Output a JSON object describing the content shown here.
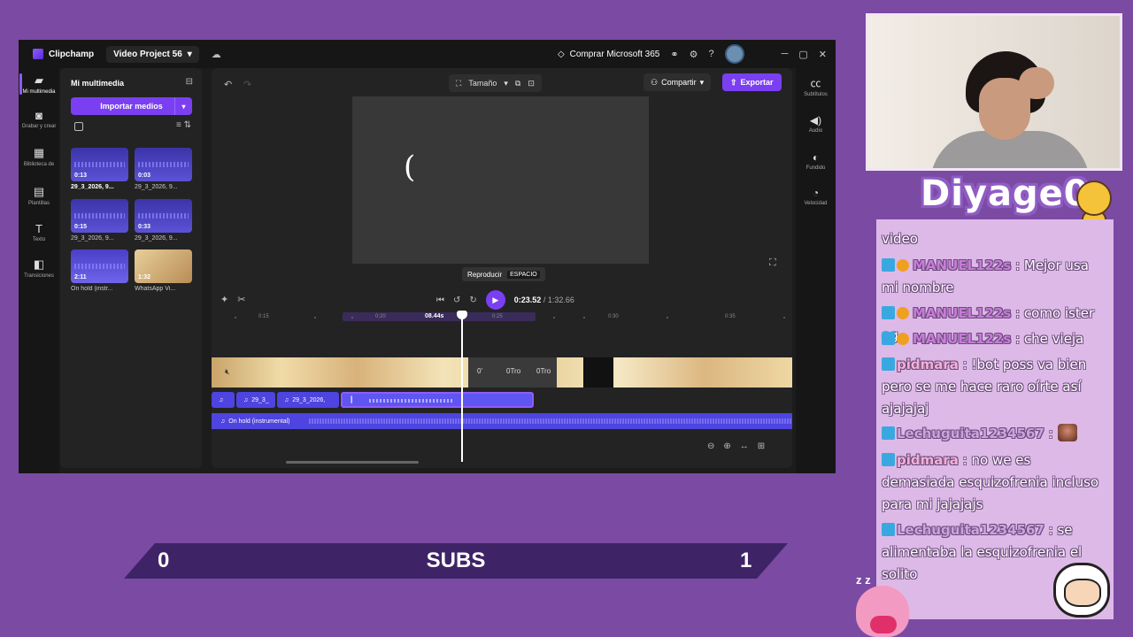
{
  "app": {
    "name": "Clipchamp",
    "project": "Video Project 56",
    "buy_label": "Comprar Microsoft 365",
    "win_min": "─",
    "win_max": "▢",
    "win_close": "✕"
  },
  "left_rail": [
    {
      "icon": "folder-icon",
      "glyph": "▰",
      "label": "Mi multimedia"
    },
    {
      "icon": "camera-icon",
      "glyph": "◙",
      "label": "Grabar y crear"
    },
    {
      "icon": "library-icon",
      "glyph": "▦",
      "label": "Biblioteca de"
    },
    {
      "icon": "templates-icon",
      "glyph": "▤",
      "label": "Plantillas"
    },
    {
      "icon": "text-icon",
      "glyph": "T",
      "label": "Texto"
    },
    {
      "icon": "transitions-icon",
      "glyph": "◧",
      "label": "Transiciones"
    }
  ],
  "media": {
    "title": "Mi multimedia",
    "import_label": "Importar medios",
    "items": [
      {
        "duration": "0:13",
        "label": "29_3_2026, 9...",
        "kind": "audio"
      },
      {
        "duration": "0:03",
        "label": "29_3_2026, 9...",
        "kind": "audio"
      },
      {
        "duration": "0:15",
        "label": "29_3_2026, 9...",
        "kind": "audio"
      },
      {
        "duration": "0:33",
        "label": "29_3_2026, 9...",
        "kind": "audio"
      },
      {
        "duration": "2:11",
        "label": "On hold (instr...",
        "kind": "audio"
      },
      {
        "duration": "1:32",
        "label": "WhatsApp Vi...",
        "kind": "video"
      }
    ]
  },
  "editor": {
    "size_label": "Tamaño",
    "share_label": "Compartir",
    "export_label": "Exportar",
    "preview_glyph": "(",
    "tooltip_label": "Reproducir",
    "tooltip_key": "ESPACIO",
    "time_current": "0:23.52",
    "time_total": "/ 1:32.66",
    "ruler_ticks": [
      "0:15",
      "0:20",
      "0:25",
      "0:30",
      "0:35"
    ],
    "cursor_label": "08.44s",
    "video_labels": [
      "0'",
      "0Tro",
      "0Tro"
    ],
    "audio_clips": [
      "29_3_",
      "29_3_2026,"
    ],
    "background_track": "On hold (instrumental)"
  },
  "right_rail": [
    {
      "icon": "captions-icon",
      "glyph": "㏄",
      "label": "Subtítulos"
    },
    {
      "icon": "audio-icon",
      "glyph": "◀)",
      "label": "Audio"
    },
    {
      "icon": "fade-icon",
      "glyph": "◐",
      "label": "Fundido"
    },
    {
      "icon": "speed-icon",
      "glyph": "◔",
      "label": "Velocidad"
    }
  ],
  "subs": {
    "left": "0",
    "center": "SUBS",
    "right": "1"
  },
  "logo": "Diyage0",
  "chat": [
    {
      "user": "",
      "text": "video"
    },
    {
      "user": "MANUEL122s",
      "text": ": Mejor usa mi nombre"
    },
    {
      "user": "MANUEL122s",
      "text": ": como ister eg"
    },
    {
      "user": "MANUEL122s",
      "text": ": che vieja"
    },
    {
      "user": "pidmara",
      "text": ": !bot poss va bien pero se me hace raro oírte así ajajajaj"
    },
    {
      "user": "Lechuguita1234567",
      "text": ":"
    },
    {
      "user": "pidmara",
      "text": ": no we es demasiada esquizofrenia incluso para mi jajajajs"
    },
    {
      "user": "Lechuguita1234567",
      "text": ": se alimentaba la esquizofrenia el solito"
    }
  ],
  "kirby_zz": "z z"
}
